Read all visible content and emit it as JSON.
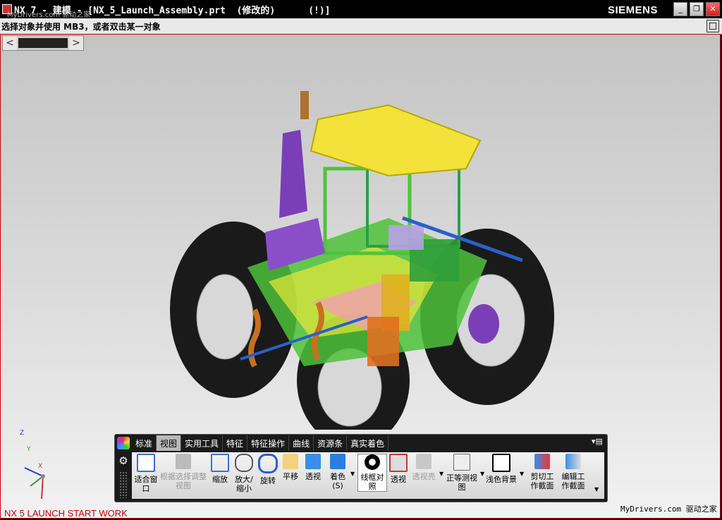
{
  "titlebar": {
    "title": "NX 7 - 建模 - [NX_5_Launch_Assembly.prt  (修改的)      (!)]",
    "watermark": "MyDrivers.com 驱动之家",
    "brand": "SIEMENS",
    "buttons": {
      "minimize": "_",
      "maximize": "❐",
      "close": "✕"
    }
  },
  "status": {
    "prompt": "选择对象并使用 MB3，或者双击某一对象"
  },
  "scroller": {
    "left": "<",
    "right": ">"
  },
  "triad": {
    "x": "X",
    "y": "Y",
    "z": "Z"
  },
  "footer": {
    "left_text": "NX 5 LAUNCH START WORK",
    "right_text": "MyDrivers.com 驱动之家"
  },
  "toolbar": {
    "tabs": [
      "标准",
      "视图",
      "实用工具",
      "特征",
      "特征操作",
      "曲线",
      "资源条",
      "真实着色"
    ],
    "active_tab": "视图",
    "menu_glyph": "▾▤",
    "gear_glyph": "⚙",
    "tools": [
      {
        "label": "适合窗口",
        "icon": "fit-icon",
        "enabled": true
      },
      {
        "label": "根据选择调整视图",
        "icon": "fit-selection-icon",
        "enabled": false
      },
      {
        "label": "缩放",
        "icon": "zoom-icon",
        "enabled": true
      },
      {
        "label": "放大/缩小",
        "icon": "zoom-in-out-icon",
        "enabled": true
      },
      {
        "label": "旋转",
        "icon": "rotate-icon",
        "enabled": true
      },
      {
        "label": "平移",
        "icon": "pan-icon",
        "enabled": true
      },
      {
        "label": "透视",
        "icon": "perspective-icon",
        "enabled": true
      },
      {
        "label": "着色(S)",
        "icon": "shaded-icon",
        "enabled": true
      },
      {
        "label": "线框对照",
        "icon": "wireframe-icon",
        "enabled": true
      },
      {
        "label": "透视",
        "icon": "see-through-icon",
        "enabled": true
      },
      {
        "label": "透视壳",
        "icon": "see-through-shell-icon",
        "enabled": false
      },
      {
        "label": "正等测视图",
        "icon": "isometric-icon",
        "enabled": true
      },
      {
        "label": "浅色背景",
        "icon": "light-background-icon",
        "enabled": true
      },
      {
        "label": "剪切工作截面",
        "icon": "clip-section-icon",
        "enabled": true
      },
      {
        "label": "编辑工作截面",
        "icon": "edit-section-icon",
        "enabled": true
      }
    ]
  },
  "colors": {
    "viewport_border": "#cc0000",
    "cab_roof": "#f2e23a",
    "frame": "#4fc23a",
    "exhaust": "#7a3fb8",
    "tire": "#1a1a1a"
  }
}
